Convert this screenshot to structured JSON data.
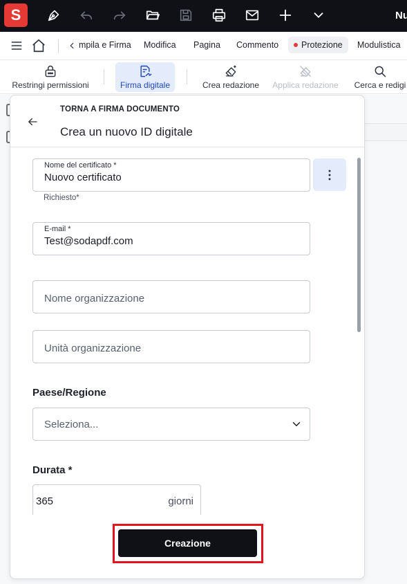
{
  "titlebar": {
    "logo_letter": "S",
    "doc_title": "Nu",
    "icons": [
      "pen-icon",
      "undo-icon",
      "redo-icon",
      "open-folder-icon",
      "save-icon",
      "print-icon",
      "mail-icon",
      "plus-icon",
      "chevron-down-icon"
    ]
  },
  "menubar": {
    "tabs": [
      "mpila e Firma",
      "Modifica",
      "Pagina",
      "Commento",
      "Protezione",
      "Modulistica"
    ],
    "active_tab": "Protezione"
  },
  "toolbar": {
    "restrict": "Restringi permissioni",
    "sign": "Firma digitale",
    "redact": "Crea redazione",
    "apply_redact": "Applica redazione",
    "search_redact": "Cerca e redigi"
  },
  "panel": {
    "back_link": "TORNA A FIRMA DOCUMENTO",
    "title": "Crea un nuovo ID digitale",
    "cert_name_label": "Nome del certificato *",
    "cert_name_value": "Nuovo certificato",
    "cert_required": "Richiesto*",
    "email_label": "E-mail *",
    "email_value": "Test@sodapdf.com",
    "org_name_placeholder": "Nome organizzazione",
    "org_unit_placeholder": "Unità organizzazione",
    "country_label": "Paese/Regione",
    "country_value": "Seleziona...",
    "duration_label": "Durata *",
    "duration_value": "365",
    "duration_unit": "giorni",
    "create_button": "Creazione"
  },
  "colors": {
    "titlebar_bg": "#0f1117",
    "logo_red": "#e53935",
    "active_tool_bg": "#e4ecfb",
    "active_tool_text": "#1f47b5",
    "highlight_red": "#e3141b",
    "button_bg": "#0f1117"
  }
}
